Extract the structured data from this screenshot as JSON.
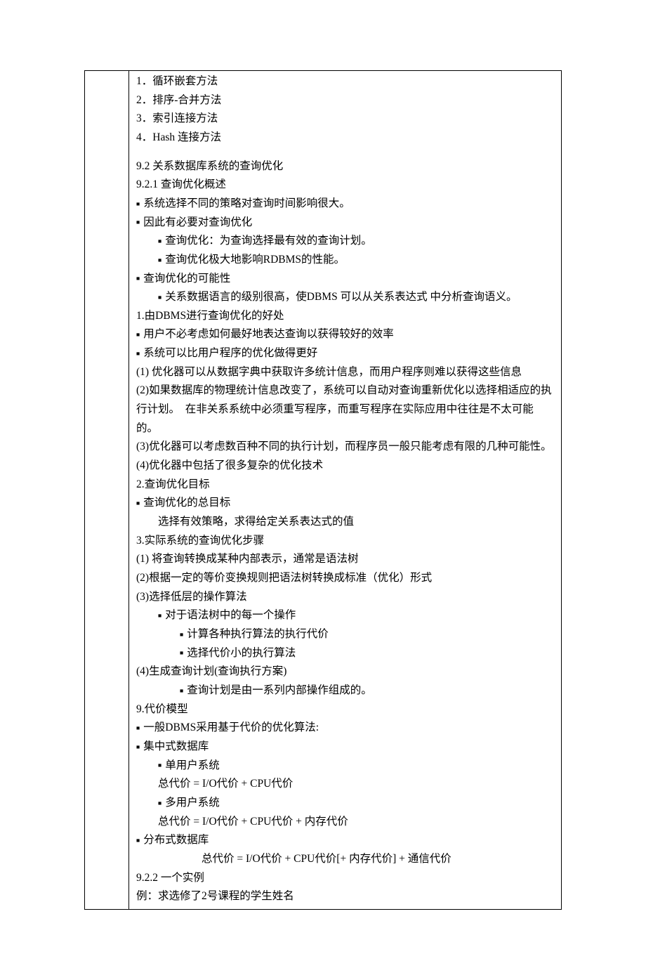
{
  "lines": {
    "l01": "1．循环嵌套方法",
    "l02": "2．排序-合并方法",
    "l03": "3．索引连接方法",
    "l04": "4．Hash 连接方法",
    "l05": "9.2 关系数据库系统的查询优化",
    "l06": "9.2.1 查询优化概述",
    "l07": "系统选择不同的策略对查询时间影响很大。",
    "l08": "因此有必要对查询优化",
    "l09": "查询优化：为查询选择最有效的查询计划。",
    "l10": "查询优化极大地影响RDBMS的性能。",
    "l11": "查询优化的可能性",
    "l12": "关系数据语言的级别很高，使DBMS 可以从关系表达式 中分析查询语义。",
    "l13": "1.由DBMS进行查询优化的好处",
    "l14": "用户不必考虑如何最好地表达查询以获得较好的效率",
    "l15": "系统可以比用户程序的优化做得更好",
    "l16": "(1) 优化器可以从数据字典中获取许多统计信息，而用户程序则难以获得这些信息",
    "l17": "(2)如果数据库的物理统计信息改变了，系统可以自动对查询重新优化以选择相适应的执行计划。　在非关系系统中必须重写程序，而重写程序在实际应用中往往是不太可能的。",
    "l18": "(3)优化器可以考虑数百种不同的执行计划，而程序员一般只能考虑有限的几种可能性。",
    "l19": "(4)优化器中包括了很多复杂的优化技术",
    "l20": "2.查询优化目标",
    "l21": "查询优化的总目标",
    "l22": "选择有效策略，求得给定关系表达式的值",
    "l23": "3.实际系统的查询优化步骤",
    "l24": "(1) 将查询转换成某种内部表示，通常是语法树",
    "l25": "(2)根据一定的等价变换规则把语法树转换成标准（优化）形式",
    "l26": "(3)选择低层的操作算法",
    "l27": "对于语法树中的每一个操作",
    "l28": "计算各种执行算法的执行代价",
    "l29": "选择代价小的执行算法",
    "l30": "(4)生成查询计划(查询执行方案)",
    "l31": "查询计划是由一系列内部操作组成的。",
    "l32": "9.代价模型",
    "l33": "一般DBMS采用基于代价的优化算法:",
    "l34": "集中式数据库",
    "l35": "单用户系统",
    "l36": "总代价 = I/O代价 + CPU代价",
    "l37": "多用户系统",
    "l38": "总代价 = I/O代价 + CPU代价 + 内存代价",
    "l39": "分布式数据库",
    "l40": "总代价 = I/O代价 + CPU代价[+ 内存代价] + 通信代价",
    "l41": "9.2.2 一个实例",
    "l42": "例：求选修了2号课程的学生姓名"
  }
}
